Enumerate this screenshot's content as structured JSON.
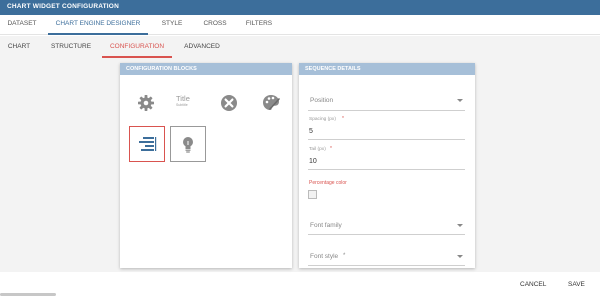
{
  "window": {
    "title": "CHART WIDGET CONFIGURATION"
  },
  "main_tabs": [
    {
      "label": "DATASET"
    },
    {
      "label": "CHART ENGINE DESIGNER"
    },
    {
      "label": "STYLE"
    },
    {
      "label": "CROSS"
    },
    {
      "label": "FILTERS"
    }
  ],
  "sub_tabs": [
    {
      "label": "CHART"
    },
    {
      "label": "STRUCTURE"
    },
    {
      "label": "CONFIGURATION"
    },
    {
      "label": "ADVANCED"
    }
  ],
  "active_main_tab": "CHART ENGINE DESIGNER",
  "active_sub_tab": "CONFIGURATION",
  "blocks_panel": {
    "title": "CONFIGURATION BLOCKS",
    "title_icon_text": "Title",
    "title_icon_subtext": "Subtitle",
    "icons": [
      "gear-icon",
      "title-subtitle-icon",
      "close-circle-icon",
      "palette-icon",
      "sequence-icon",
      "lightbulb-icon"
    ]
  },
  "sequence_panel": {
    "title": "SEQUENCE DETAILS",
    "position_placeholder": "Position",
    "spacing_label": "Spacing (px)",
    "spacing_value": "5",
    "tail_label": "Tail (px)",
    "tail_value": "10",
    "percentage_color_label": "Percentage color",
    "font_family_placeholder": "Font family",
    "font_style_placeholder": "Font style"
  },
  "actions": {
    "cancel": "CANCEL",
    "save": "SAVE"
  },
  "colors": {
    "header": "#3c6e9b",
    "panel_header": "#a6bfd8",
    "accent": "#d9534f"
  }
}
